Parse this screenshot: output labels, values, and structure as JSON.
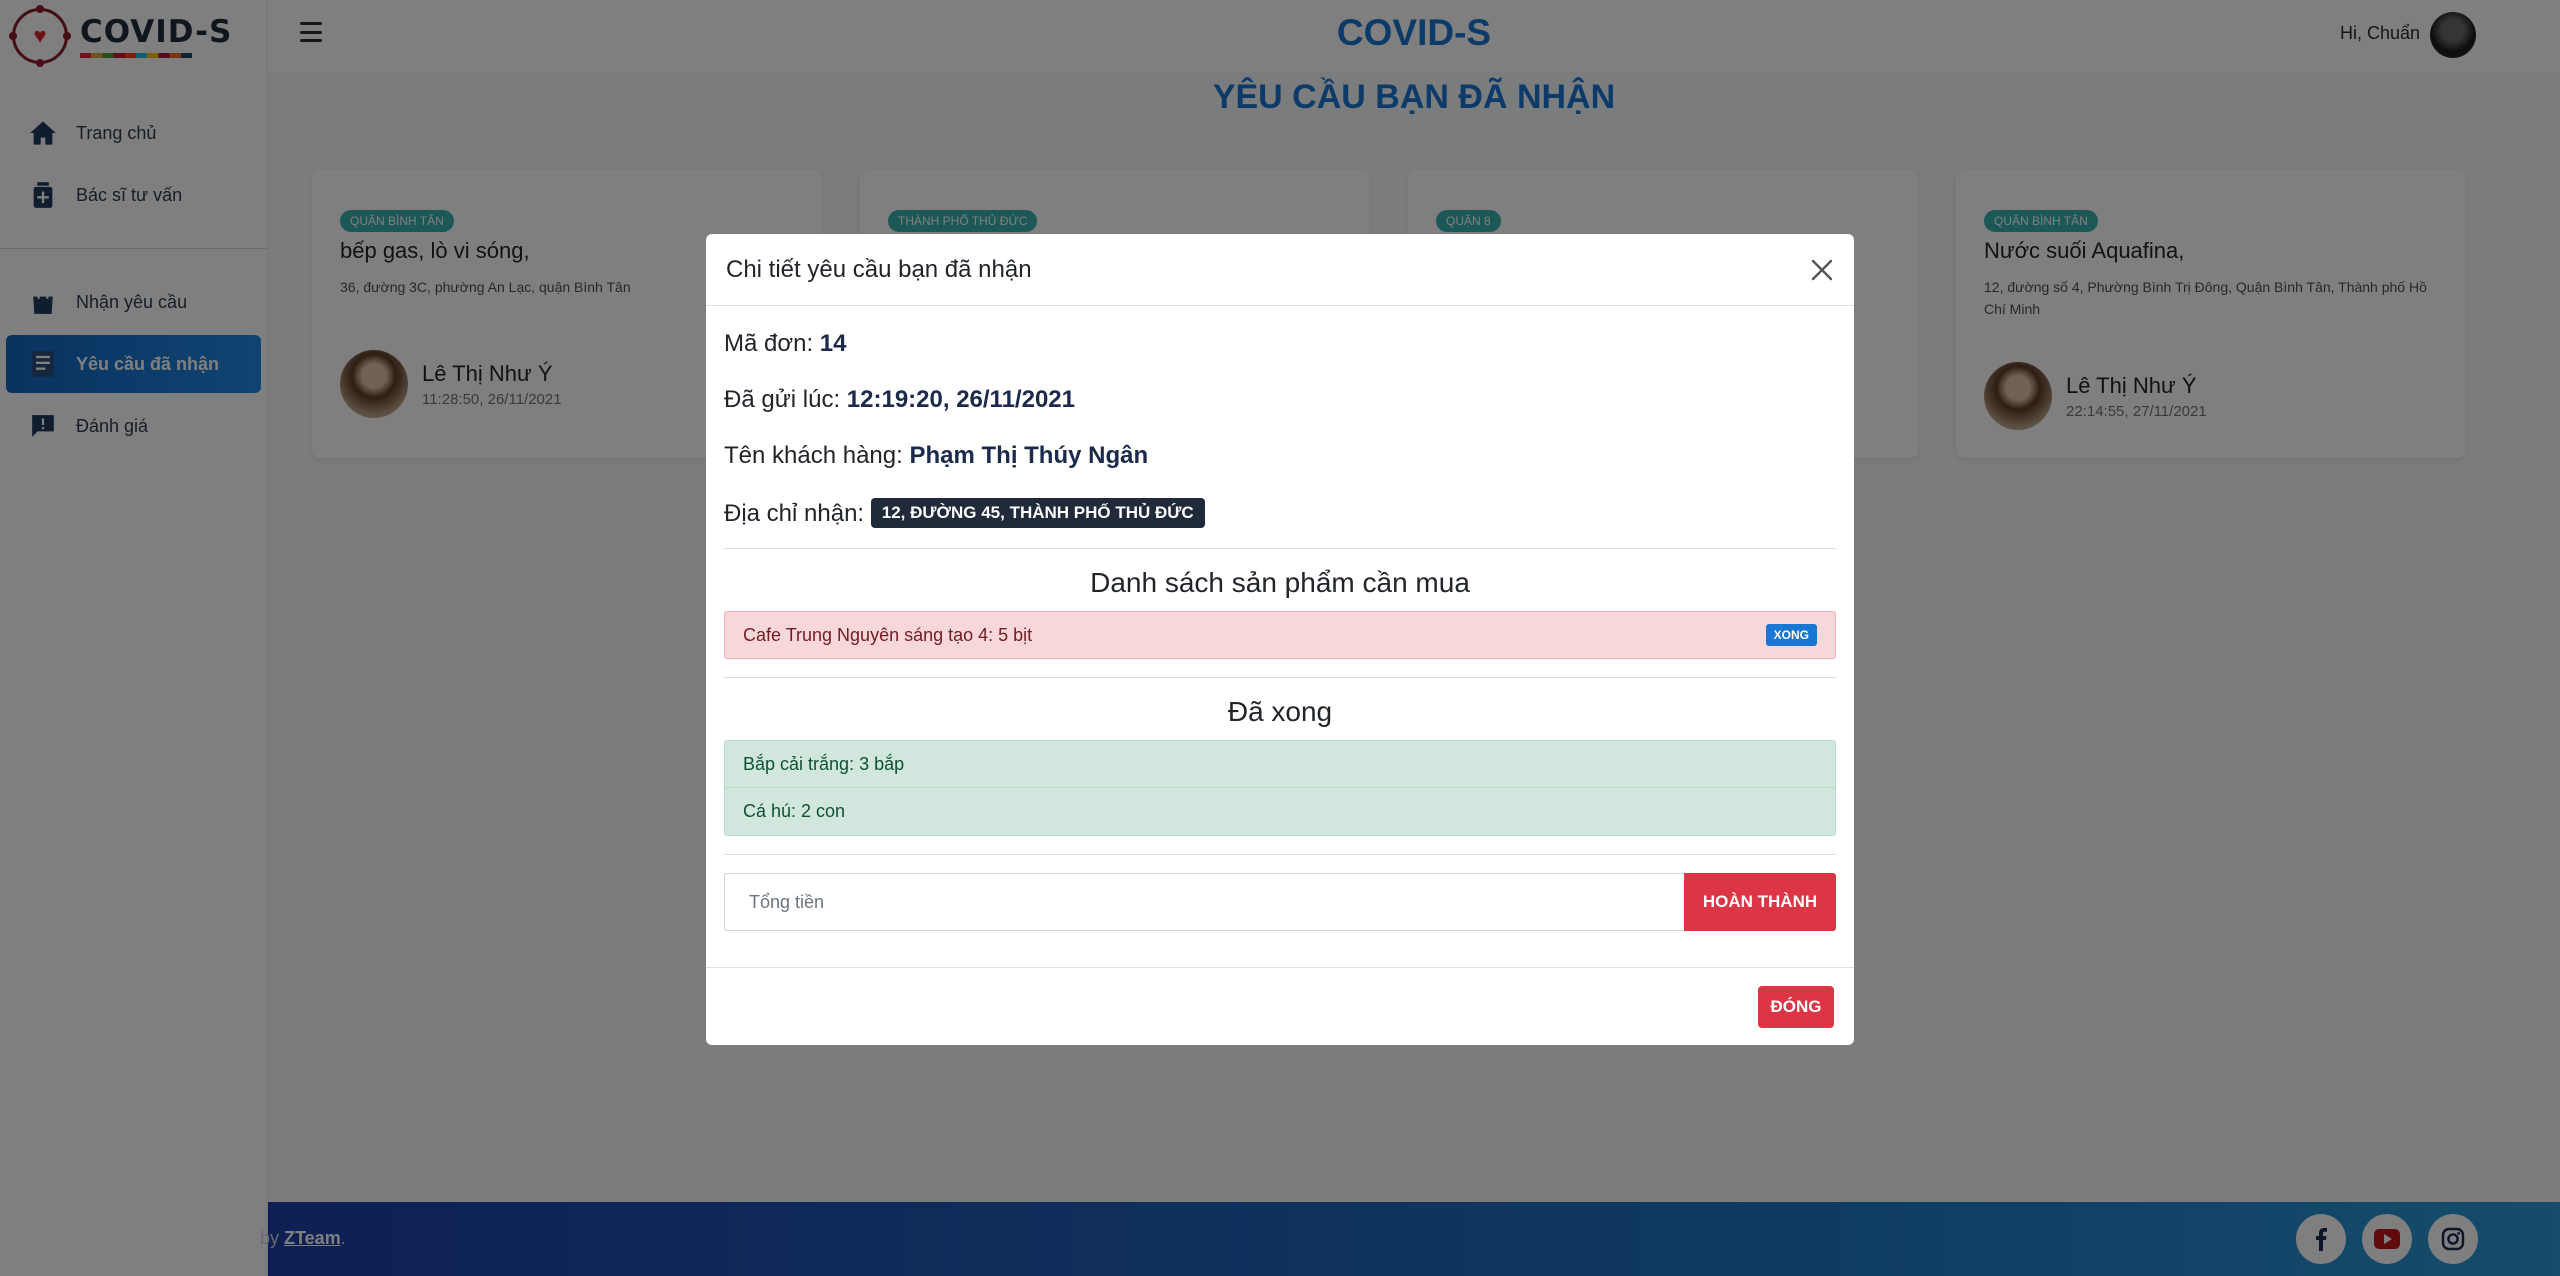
{
  "brand": {
    "name": "COVID-S"
  },
  "sidebar": {
    "items": [
      {
        "label": "Trang chủ",
        "icon": "home-icon"
      },
      {
        "label": "Bác sĩ tư vấn",
        "icon": "medical-kit-icon"
      },
      {
        "label": "Nhận yêu cầu",
        "icon": "shopping-bag-icon"
      },
      {
        "label": "Yêu cầu đã nhận",
        "icon": "receipt-icon",
        "active": true
      },
      {
        "label": "Đánh giá",
        "icon": "feedback-icon"
      }
    ]
  },
  "header": {
    "title": "COVID-S",
    "greeting": "Hi, Chuẩn"
  },
  "main": {
    "title": "YÊU CẦU BẠN ĐÃ NHẬN",
    "cards": [
      {
        "badge": "QUẬN BÌNH TÂN",
        "title": "bếp gas, lò vi sóng,",
        "address": "36, đường 3C, phường An Lạc, quận Bình Tân",
        "user": "Lê Thị Như Ý",
        "time": "11:28:50, 26/11/2021"
      },
      {
        "badge": "THÀNH PHỐ THỦ ĐỨC",
        "title": "",
        "address": "",
        "user": "",
        "time": ""
      },
      {
        "badge": "QUẬN 8",
        "title": "",
        "address": "",
        "user": "",
        "time": ""
      },
      {
        "badge": "QUẬN BÌNH TÂN",
        "title": "Nước suối Aquafina,",
        "address": "12, đường số 4, Phường Bình Trị Đông, Quận Bình Tân, Thành phố Hồ Chí Minh",
        "user": "Lê Thị Như Ý",
        "time": "22:14:55, 27/11/2021"
      }
    ]
  },
  "footer": {
    "prefix": "by ",
    "brand": "ZTeam",
    "suffix": "."
  },
  "modal": {
    "title": "Chi tiết yêu cầu bạn đã nhận",
    "order_label": "Mã đơn:",
    "order_id": "14",
    "sent_label": "Đã gửi lúc:",
    "sent_time": "12:19:20, 26/11/2021",
    "customer_label": "Tên khách hàng:",
    "customer_name": "Phạm Thị Thúy Ngân",
    "address_label": "Địa chỉ nhận:",
    "address": "12, ĐƯỜNG 45, THÀNH PHỐ THỦ ĐỨC",
    "pending_title": "Danh sách sản phẩm cần mua",
    "pending_items": [
      {
        "text": "Cafe Trung Nguyên sáng tạo 4: 5 bịt",
        "action": "XONG"
      }
    ],
    "done_title": "Đã xong",
    "done_items": [
      {
        "text": "Bắp cải trắng: 3 bắp"
      },
      {
        "text": "Cá hú: 2 con"
      }
    ],
    "total_placeholder": "Tổng tiền",
    "total_value": "",
    "complete_label": "HOÀN THÀNH",
    "close_label": "ĐÓNG"
  },
  "colors": {
    "primary": "#1976d2",
    "danger": "#dc3545",
    "badge": "#38b2ac",
    "pending_bg": "#f8d7da",
    "done_bg": "#d1e7dd"
  }
}
